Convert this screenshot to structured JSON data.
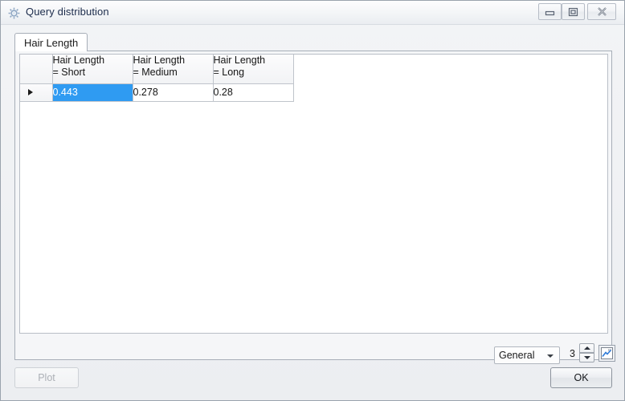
{
  "window": {
    "title": "Query distribution",
    "icon": "gear-icon",
    "controls": {
      "minimize": "minimize-icon",
      "maximize": "maximize-icon",
      "close": "close-icon"
    }
  },
  "tabs": [
    {
      "label": "Hair Length",
      "active": true
    }
  ],
  "grid": {
    "columns": [
      {
        "label": "Hair Length\n= Short"
      },
      {
        "label": "Hair Length\n= Medium"
      },
      {
        "label": "Hair Length\n= Long"
      }
    ],
    "rows": [
      {
        "indicator": "current-row-arrow",
        "cells": [
          {
            "value": "0.443",
            "selected": true
          },
          {
            "value": "0.278",
            "selected": false
          },
          {
            "value": "0.28",
            "selected": false
          }
        ]
      }
    ]
  },
  "format_controls": {
    "format_label": "General",
    "format_options": [
      "General"
    ],
    "precision_value": "3",
    "chart_button_icon": "line-chart-icon",
    "spinner_up_icon": "triangle-up-icon",
    "spinner_down_icon": "triangle-down-icon"
  },
  "footer": {
    "plot_label": "Plot",
    "plot_enabled": false,
    "ok_label": "OK",
    "ok_enabled": true
  },
  "colors": {
    "selection_blue": "#2f9bf2",
    "title_text": "#1b2b4b",
    "disabled_text": "#acb0b6"
  }
}
